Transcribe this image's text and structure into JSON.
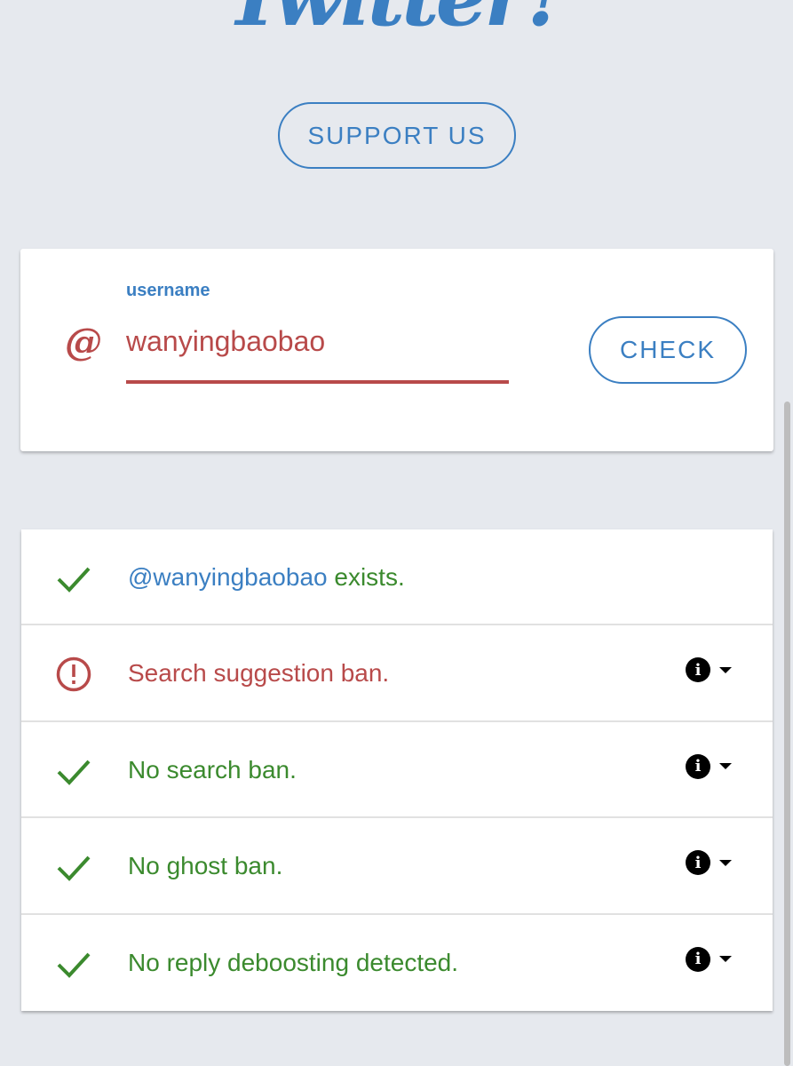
{
  "header": {
    "title": "Twitter?"
  },
  "support": {
    "label": "SUPPORT US"
  },
  "search": {
    "at_symbol": "@",
    "field_label": "username",
    "value": "wanyingbaobao",
    "check_label": "CHECK"
  },
  "results": [
    {
      "status": "ok",
      "icon": "check-icon",
      "handle": "@wanyingbaobao",
      "text": " exists.",
      "info": false
    },
    {
      "status": "error",
      "icon": "alert-circle-icon",
      "handle": "",
      "text": "Search suggestion ban.",
      "info": true
    },
    {
      "status": "ok",
      "icon": "check-icon",
      "handle": "",
      "text": "No search ban.",
      "info": true
    },
    {
      "status": "ok",
      "icon": "check-icon",
      "handle": "",
      "text": "No ghost ban.",
      "info": true
    },
    {
      "status": "ok",
      "icon": "check-icon",
      "handle": "",
      "text": "No reply deboosting detected.",
      "info": true
    }
  ],
  "colors": {
    "accent_blue": "#3b7fc2",
    "ok_green": "#3b8a2e",
    "error_red": "#b84a4a",
    "background": "#e6e9ee"
  }
}
